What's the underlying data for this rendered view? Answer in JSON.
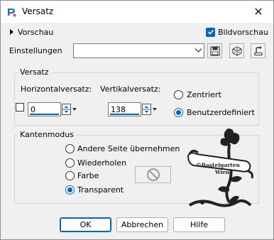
{
  "window": {
    "title": "Versatz",
    "close_label": "✕"
  },
  "top": {
    "preview_label": "Vorschau",
    "preview_image_label": "Bildvorschau",
    "preview_image_checked": true
  },
  "settings": {
    "label": "Einstellungen",
    "value": ""
  },
  "offset_group": {
    "title": "Versatz",
    "horizontal_label": "Horizontalversatz:",
    "vertical_label": "Vertikalversatz:",
    "horizontal_value": "0",
    "vertical_value": "138",
    "centered_label": "Zentriert",
    "custom_label": "Benutzerdefiniert",
    "selected": "custom"
  },
  "edge_group": {
    "title": "Kantenmodus",
    "options": [
      "Andere Seite übernehmen",
      "Wiederholen",
      "Farbe",
      "Transparent"
    ],
    "selected": "Transparent"
  },
  "watermark": {
    "line1": "©Bastelgarten",
    "line2": "Wien"
  },
  "buttons": {
    "ok": "OK",
    "cancel": "Abbrechen",
    "help": "Hilfe"
  },
  "colors": {
    "accent": "#0067c0",
    "background": "#f0f0f0"
  }
}
